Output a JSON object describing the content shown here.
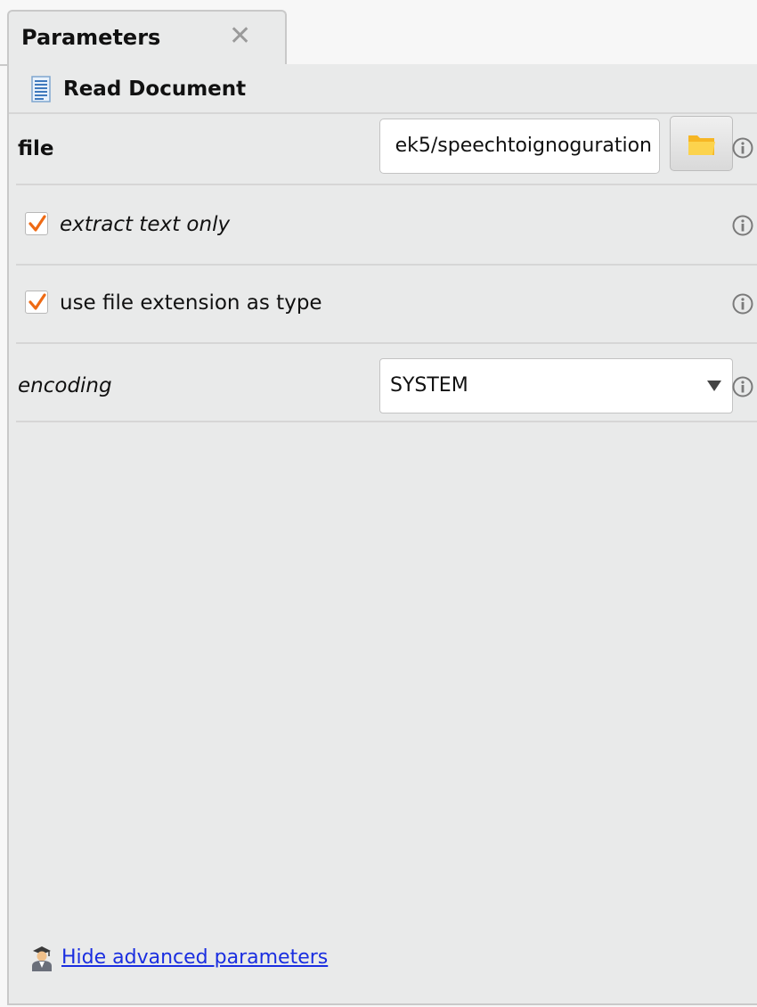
{
  "tab": {
    "title": "Parameters",
    "close_icon": "close-icon"
  },
  "operator": {
    "icon": "document-icon",
    "title": "Read Document"
  },
  "params": {
    "file": {
      "label": "file",
      "value": "ek5/speechtoignoguration",
      "browse_icon": "folder-icon",
      "info_icon": "info-icon"
    },
    "extract_text_only": {
      "label": "extract text only",
      "checked": true,
      "info_icon": "info-icon"
    },
    "use_file_extension": {
      "label": "use file extension as type",
      "checked": true,
      "info_icon": "info-icon"
    },
    "encoding": {
      "label": "encoding",
      "value": "SYSTEM",
      "info_icon": "info-icon"
    }
  },
  "footer": {
    "icon": "expert-user-icon",
    "link_label": "Hide advanced parameters"
  },
  "colors": {
    "panel_bg": "#e9eaea",
    "check_accent": "#ee6a14",
    "link": "#1a2ee0",
    "folder": "#f6b624"
  }
}
